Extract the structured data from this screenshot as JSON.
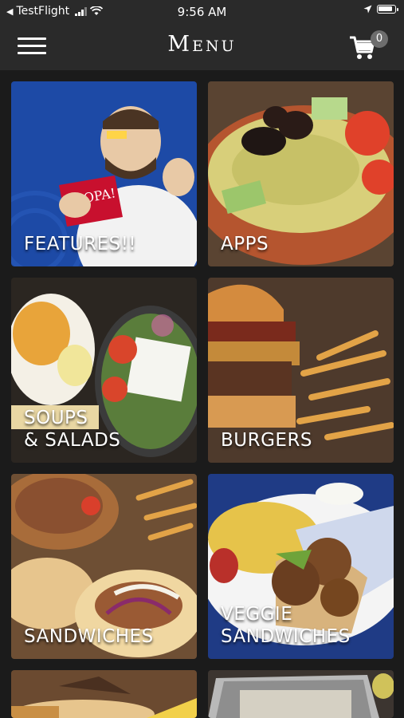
{
  "status_bar": {
    "carrier": "TestFlight",
    "time": "9:56 AM"
  },
  "nav": {
    "title": "Menu",
    "cart_count": "0"
  },
  "tiles": [
    {
      "label": "FEATURES!!",
      "image": "mascot holding OPA! card"
    },
    {
      "label": "APPS",
      "image": "hummus plate with olives"
    },
    {
      "label": "SOUPS\n& SALADS",
      "image": "soup cup and greek salad"
    },
    {
      "label": "BURGERS",
      "image": "burger with fries"
    },
    {
      "label": "SANDWICHES",
      "image": "gyro pita sandwiches with fries"
    },
    {
      "label": "VEGGIE\nSANDWICHES",
      "image": "falafel pita with rice"
    },
    {
      "label": "",
      "image": "sandwich platter"
    },
    {
      "label": "",
      "image": "catering tray"
    }
  ],
  "colors": {
    "bar_bg": "#2a2a2a",
    "grid_bg": "#1b1b1b",
    "badge_bg": "#6d6d6d"
  }
}
